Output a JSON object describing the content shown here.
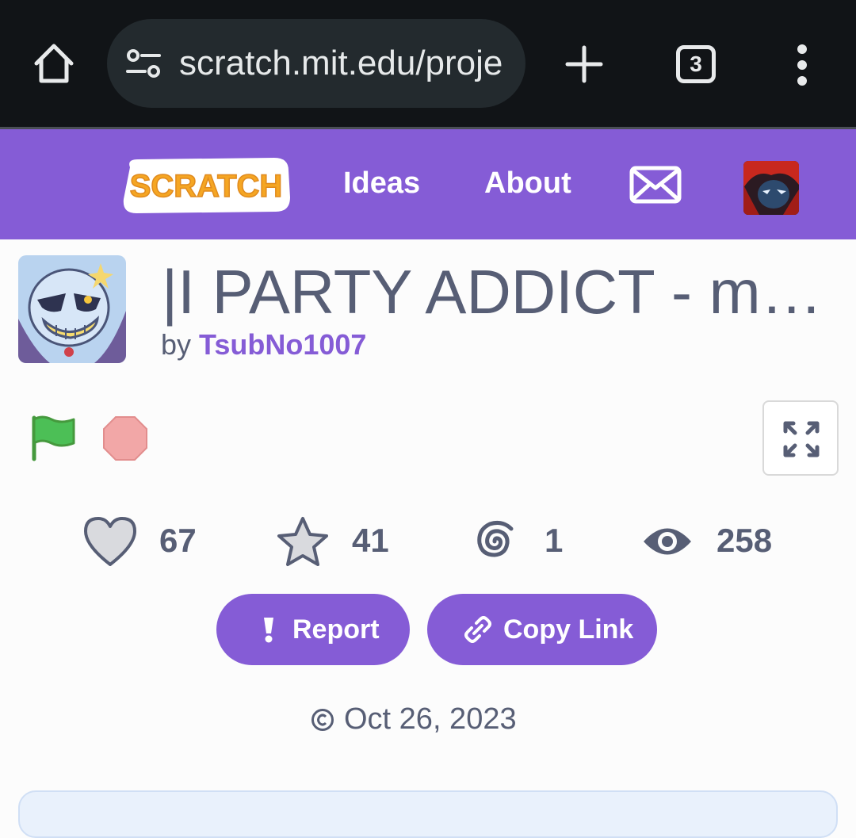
{
  "browser": {
    "url": "scratch.mit.edu/proje",
    "tab_count": "3"
  },
  "nav": {
    "logo_text": "SCRATCH",
    "ideas_label": "Ideas",
    "about_label": "About"
  },
  "project": {
    "title": "|I PARTY ADDICT - mem...",
    "by_prefix": "by",
    "author": "TsubNo1007",
    "date": "Oct 26, 2023"
  },
  "stats": {
    "loves": "67",
    "favorites": "41",
    "remixes": "1",
    "views": "258"
  },
  "actions": {
    "report_label": "Report",
    "copy_link_label": "Copy Link"
  },
  "colors": {
    "brand_purple": "#855cd6",
    "text_gray": "#575e75",
    "flag_green": "#4cbf56",
    "stop_red": "#f2a7a7"
  }
}
